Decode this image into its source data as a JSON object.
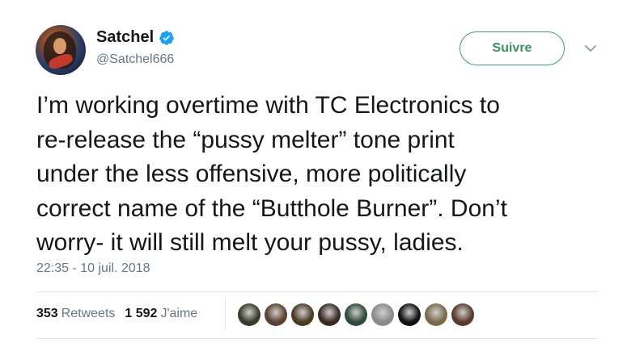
{
  "author": {
    "name": "Satchel",
    "handle": "@Satchel666",
    "verified_icon": "verified-badge-icon",
    "verified_color": "#1da1f2"
  },
  "follow_button": {
    "label": "Suivre",
    "accent": "#3d8f5f"
  },
  "more_menu_icon": "chevron-down-icon",
  "tweet": {
    "lines": [
      "I’m working overtime with TC Electronics to",
      "re-release the “pussy melter” tone print",
      "under the less offensive, more politically",
      "correct name of the “Butthole Burner”.  Don’t",
      "worry- it will still melt your pussy, ladies."
    ]
  },
  "timestamp": "22:35 - 10 juil. 2018",
  "stats": {
    "retweets_count": "353",
    "retweets_label": "Retweets",
    "likes_count": "1 592",
    "likes_label": "J'aime"
  },
  "liker_avatars": [
    {
      "name": "liker-avatar-1",
      "color": "#3a3a2a"
    },
    {
      "name": "liker-avatar-2",
      "color": "#5a4030"
    },
    {
      "name": "liker-avatar-3",
      "color": "#4a3a20"
    },
    {
      "name": "liker-avatar-4",
      "color": "#3a2a22"
    },
    {
      "name": "liker-avatar-5",
      "color": "#2e4a3a"
    },
    {
      "name": "liker-avatar-6",
      "color": "#8a8a8a"
    },
    {
      "name": "liker-avatar-7",
      "color": "#111111"
    },
    {
      "name": "liker-avatar-8",
      "color": "#7a6a4a"
    },
    {
      "name": "liker-avatar-9",
      "color": "#5a3a2a"
    }
  ]
}
